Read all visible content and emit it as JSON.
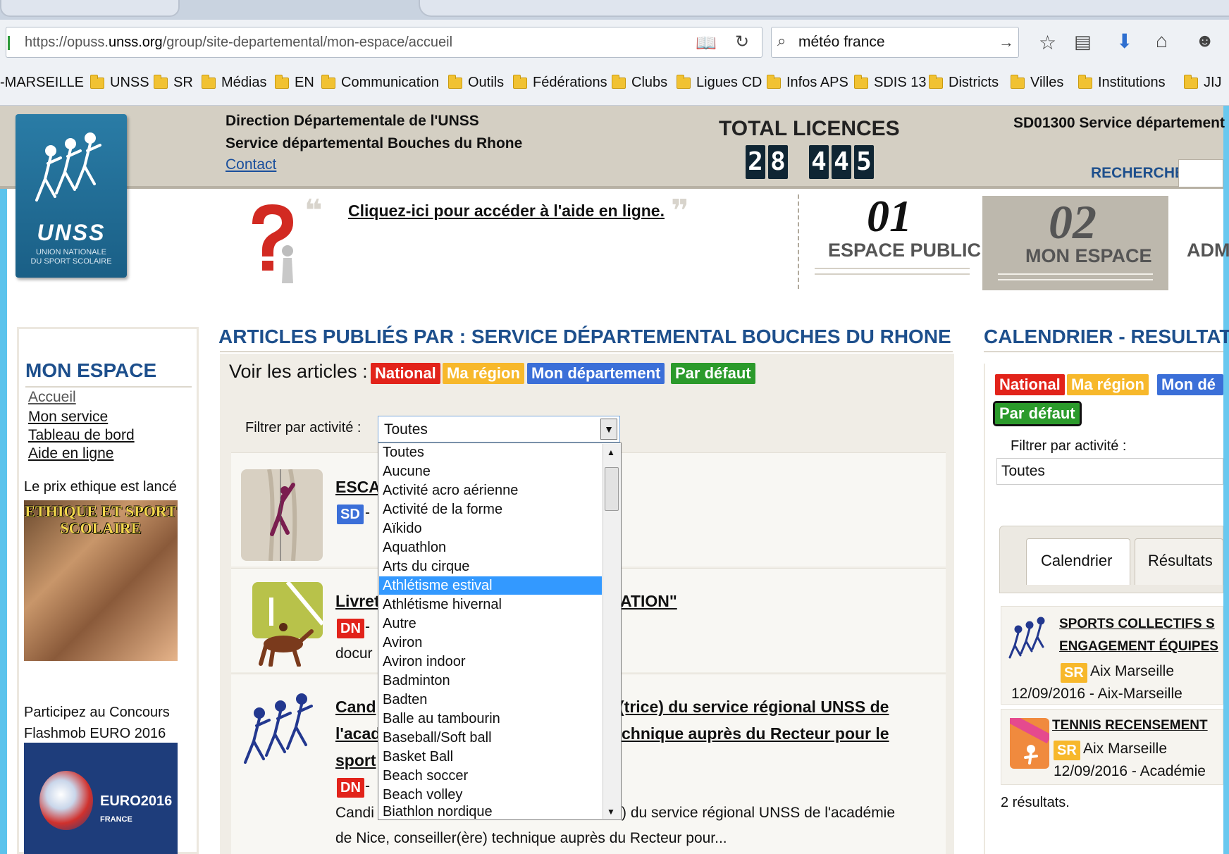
{
  "browser": {
    "url_prefix": "https://opuss.",
    "url_domain": "unss.org",
    "url_path": "/group/site-departemental/mon-espace/accueil",
    "search_text": "météo france",
    "bookmarks": [
      "-MARSEILLE",
      "UNSS",
      "SR",
      "Médias",
      "EN",
      "Communication",
      "Outils",
      "Fédérations",
      "Clubs",
      "Ligues CD",
      "Infos APS",
      "SDIS 13",
      "Districts",
      "Villes",
      "Institutions",
      "JIJ"
    ]
  },
  "header": {
    "logo_text": "UNSS",
    "logo_sub1": "UNION NATIONALE",
    "logo_sub2": "DU SPORT SCOLAIRE",
    "line1": "Direction Départementale de l'UNSS",
    "line2": "Service départemental Bouches du Rhone",
    "contact": "Contact",
    "total_title": "TOTAL LICENCES",
    "digits": [
      "2",
      "8",
      "4",
      "4",
      "5"
    ],
    "sd_text": "SD01300 Service département",
    "recherche": "RECHERCHE",
    "help_link": "Cliquez-ici pour accéder à l'aide en ligne.",
    "espace_public_num": "01",
    "espace_public": "ESPACE PUBLIC",
    "mon_espace_num": "02",
    "mon_espace": "MON ESPACE",
    "adm": "ADM"
  },
  "sidebar": {
    "title": "MON ESPACE",
    "links": [
      "Accueil",
      "Mon service",
      "Tableau de bord",
      "Aide en ligne"
    ],
    "prix": "Le prix ethique est lancé",
    "ethique_line1": "ETHIQUE ET SPORT",
    "ethique_line2": "SCOLAIRE",
    "concours_line1": "Participez au Concours",
    "concours_line2": "Flashmob EURO 2016",
    "euro_text": "EURO2016",
    "euro_sub": "FRANCE"
  },
  "main": {
    "title": "ARTICLES PUBLIÉS PAR : SERVICE DÉPARTEMENTAL BOUCHES DU RHONE",
    "voir": "Voir les articles :",
    "badges": [
      "National",
      "Ma région",
      "Mon département",
      "Par défaut"
    ],
    "filter_label": "Filtrer par activité :",
    "filter_value": "Toutes",
    "articles": [
      {
        "title": "ESCA",
        "badge": "SD",
        "sub": "-"
      },
      {
        "title": "Livret",
        "title2": "ATION\"",
        "badge": "DN",
        "sub": "-",
        "sub2": "docur"
      },
      {
        "title": "Cand",
        "title_b": "(trice) du service régional UNSS de",
        "title2": "l'acad",
        "title2_b": "chnique auprès du Recteur pour le",
        "title3": "sport",
        "badge": "DN",
        "sub": "-",
        "desc1_a": "Candi",
        "desc1_b": ") du service régional UNSS de l'académie",
        "desc2": "de Nice, conseiller(ère) technique auprès du Recteur pour..."
      }
    ],
    "dropdown": [
      "Toutes",
      "Aucune",
      "Activité acro aérienne",
      "Activité de la forme",
      "Aïkido",
      "Aquathlon",
      "Arts du cirque",
      "Athlétisme estival",
      "Athlétisme hivernal",
      "Autre",
      "Aviron",
      "Aviron indoor",
      "Badminton",
      "Badten",
      "Balle au tambourin",
      "Baseball/Soft ball",
      "Basket Ball",
      "Beach soccer",
      "Beach volley",
      "Biathlon nordique"
    ],
    "dropdown_selected": "Athlétisme estival"
  },
  "right": {
    "title": "CALENDRIER - RESULTAT",
    "badges": [
      "National",
      "Ma région",
      "Mon dé",
      "Par défaut"
    ],
    "filter_label": "Filtrer par activité :",
    "filter_value": "Toutes",
    "tab_cal": "Calendrier",
    "tab_res": "Résultats",
    "events": [
      {
        "title1": "SPORTS COLLECTIFS S",
        "title2": "ENGAGEMENT ÉQUIPES",
        "badge": "SR",
        "place": "Aix Marseille",
        "date": "12/09/2016 - Aix-Marseille"
      },
      {
        "title1": "TENNIS RECENSEMENT",
        "badge": "SR",
        "place": "Aix Marseille",
        "date": "12/09/2016 - Académie"
      }
    ],
    "count": "2 résultats."
  },
  "colors": {
    "accent_blue": "#1d4f8c",
    "national": "#e2231a",
    "region": "#f7b82b",
    "departement": "#3b6fd8",
    "defaut": "#2b9a2b"
  }
}
